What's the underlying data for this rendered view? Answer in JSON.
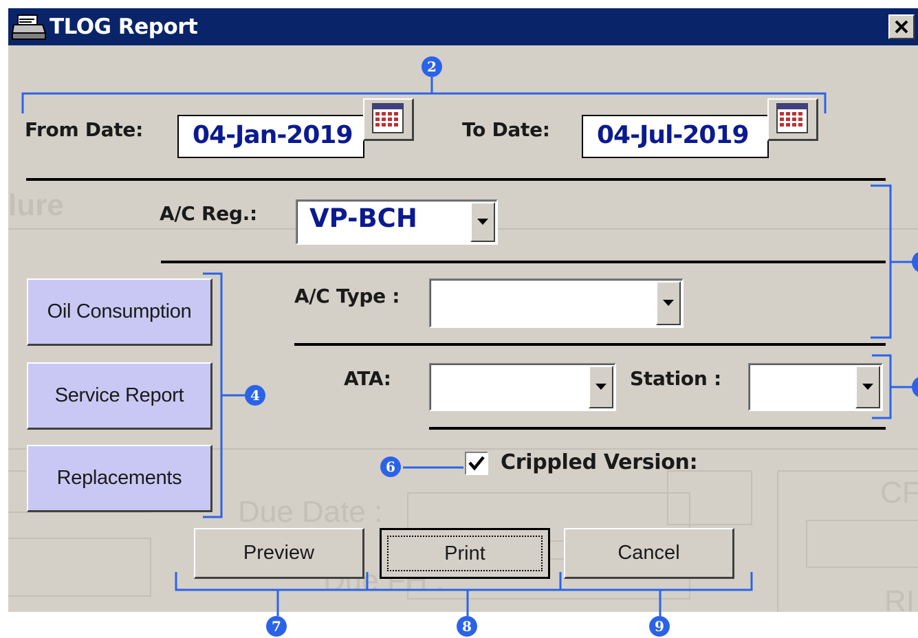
{
  "window": {
    "title": "TLOG Report",
    "close_glyph": "✕",
    "icon": "printer-icon"
  },
  "dates": {
    "from_label": "From Date:",
    "from_value": "04-Jan-2019",
    "to_label": "To Date:",
    "to_value": "04-Jul-2019",
    "calendar_icon": "calendar-icon"
  },
  "filters": {
    "ac_reg_label": "A/C Reg.:",
    "ac_reg_value": "VP-BCH",
    "ac_type_label": "A/C Type :",
    "ac_type_value": "",
    "ata_label": "ATA:",
    "ata_value": "",
    "station_label": "Station :",
    "station_value": ""
  },
  "side_buttons": [
    {
      "label": "Oil Consumption"
    },
    {
      "label": "Service Report"
    },
    {
      "label": "Replacements"
    }
  ],
  "crippled": {
    "label": "Crippled Version:",
    "checked": true
  },
  "actions": {
    "preview": "Preview",
    "print": "Print",
    "cancel": "Cancel"
  },
  "background_ghost": {
    "text1": "lure",
    "text2": "Due Date :",
    "text3": "Due FH :",
    "text4": "CF",
    "text5": "RI"
  },
  "callouts": [
    "2",
    "4",
    "6",
    "7",
    "8",
    "9"
  ],
  "colors": {
    "titlebar": "#0a246a",
    "dialog_bg": "#d4d0c8",
    "value_text": "#0a1a90",
    "side_button_bg": "#c9c8f4",
    "callout_blue": "#2b63e8"
  }
}
